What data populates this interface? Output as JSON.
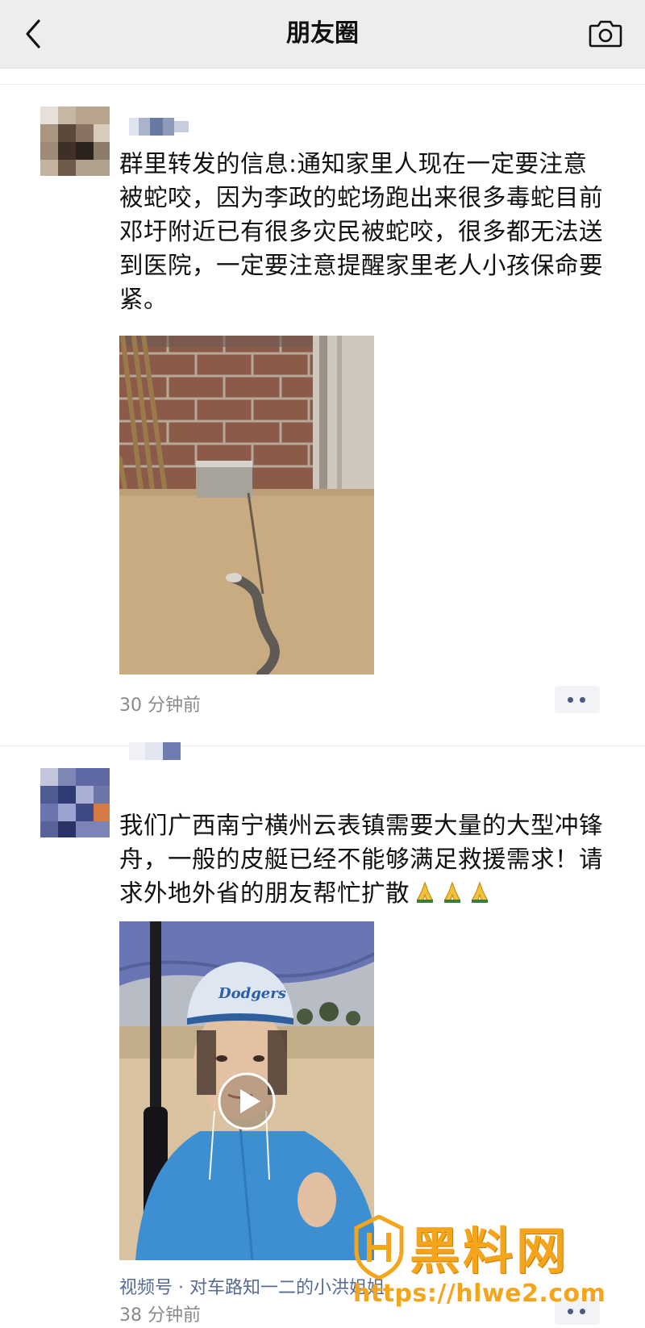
{
  "header": {
    "title": "朋友圈",
    "back_icon": "chevron-left-icon",
    "camera_icon": "camera-icon"
  },
  "posts": [
    {
      "text": "群里转发的信息:通知家里人现在一定要注意被蛇咬，因为李政的蛇场跑出来很多毒蛇目前邓圩附近已有很多灾民被蛇咬，很多都无法送到医院，一定要注意提醒家里老人小孩保命要紧。",
      "media_type": "photo",
      "time": "30 分钟前"
    },
    {
      "text": "我们广西南宁横州云表镇需要大量的大型冲锋舟，一般的皮艇已经不能够满足救援需求！请求外地外省的朋友帮忙扩散",
      "emoji_count": 3,
      "media_type": "video",
      "cap_text": "Dodgers",
      "channel_label": "视频号 · 对车路知一二的小洪姐姐",
      "time": "38 分钟前"
    }
  ],
  "watermark": {
    "brand": "黑料网",
    "url": "https://hlwe2.com"
  },
  "colors": {
    "navbar_bg": "#ededed",
    "link": "#576b95",
    "time": "#8a8a8a",
    "watermark": "#f5a51c"
  }
}
